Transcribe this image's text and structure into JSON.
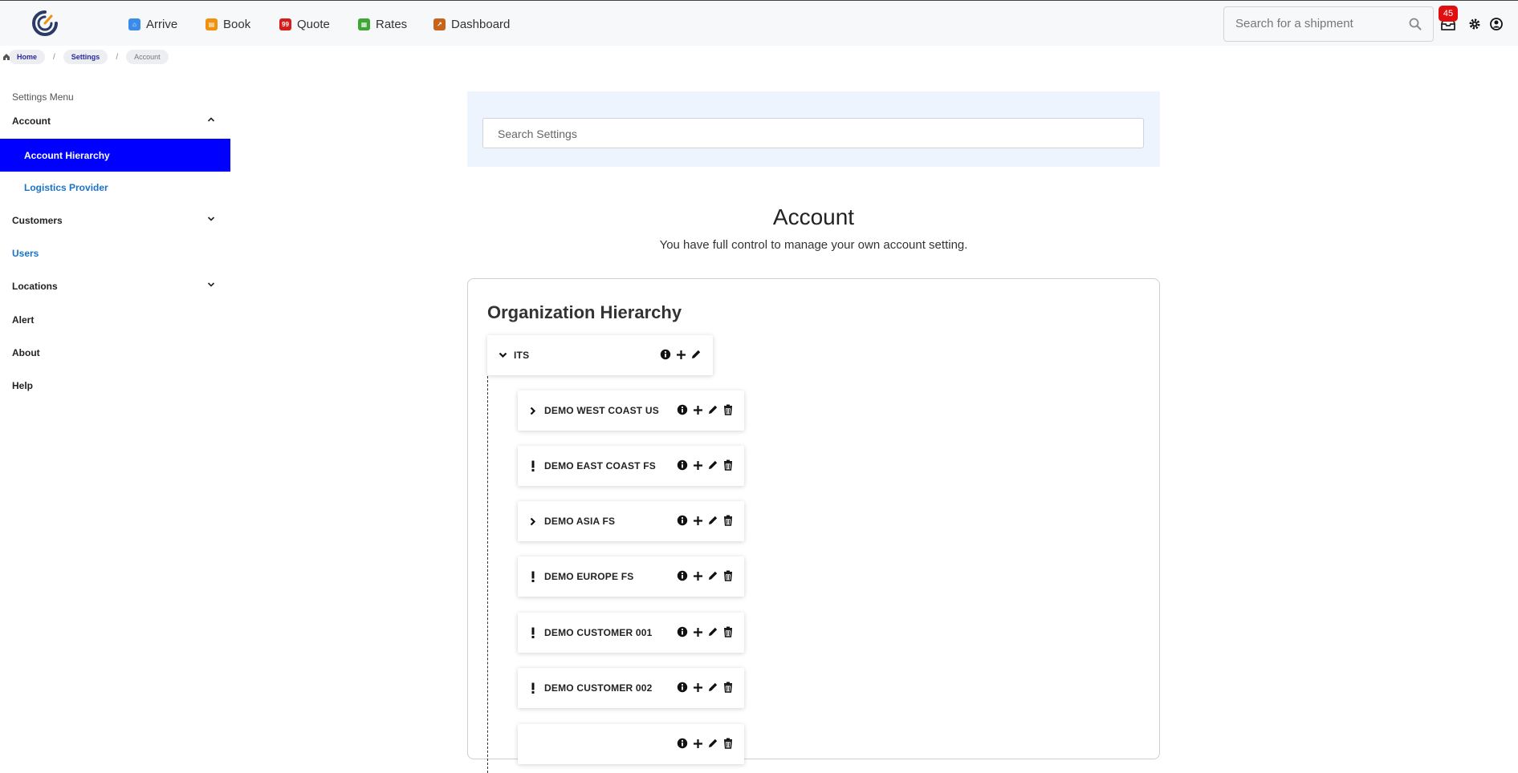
{
  "nav": {
    "items": [
      {
        "label": "Arrive",
        "icon": "arrive-icon",
        "color": "#3b8beb"
      },
      {
        "label": "Book",
        "icon": "book-icon",
        "color": "#f0920f"
      },
      {
        "label": "Quote",
        "icon": "quote-icon",
        "color": "#d81b1b"
      },
      {
        "label": "Rates",
        "icon": "rates-icon",
        "color": "#3fa535"
      },
      {
        "label": "Dashboard",
        "icon": "dashboard-icon",
        "color": "#c8641a"
      }
    ],
    "search_placeholder": "Search for a shipment",
    "inbox_count": "45"
  },
  "breadcrumb": {
    "home": "Home",
    "settings": "Settings",
    "current": "Account",
    "separator": "/"
  },
  "sidebar": {
    "title": "Settings Menu",
    "items": [
      {
        "label": "Account"
      },
      {
        "label": "Account Hierarchy"
      },
      {
        "label": "Logistics Provider"
      },
      {
        "label": "Customers"
      },
      {
        "label": "Users"
      },
      {
        "label": "Locations"
      },
      {
        "label": "Alert"
      },
      {
        "label": "About"
      },
      {
        "label": "Help"
      }
    ]
  },
  "main": {
    "search_placeholder": "Search Settings",
    "title": "Account",
    "subtitle": "You have full control to manage your own account setting.",
    "org_title": "Organization Hierarchy",
    "root": {
      "label": "ITS"
    },
    "children": [
      {
        "label": "DEMO WEST COAST US",
        "marker": "expand"
      },
      {
        "label": "DEMO EAST COAST FS",
        "marker": "alert"
      },
      {
        "label": "DEMO ASIA FS",
        "marker": "expand"
      },
      {
        "label": "DEMO EUROPE FS",
        "marker": "alert"
      },
      {
        "label": "DEMO CUSTOMER 001",
        "marker": "alert"
      },
      {
        "label": "DEMO CUSTOMER 002",
        "marker": "alert"
      },
      {
        "label": "",
        "marker": "none"
      }
    ]
  },
  "colors": {
    "active_menu_bg": "#0000ff",
    "link": "#1a73c8",
    "badge": "#e01010",
    "search_panel_bg": "#eef4fd"
  }
}
